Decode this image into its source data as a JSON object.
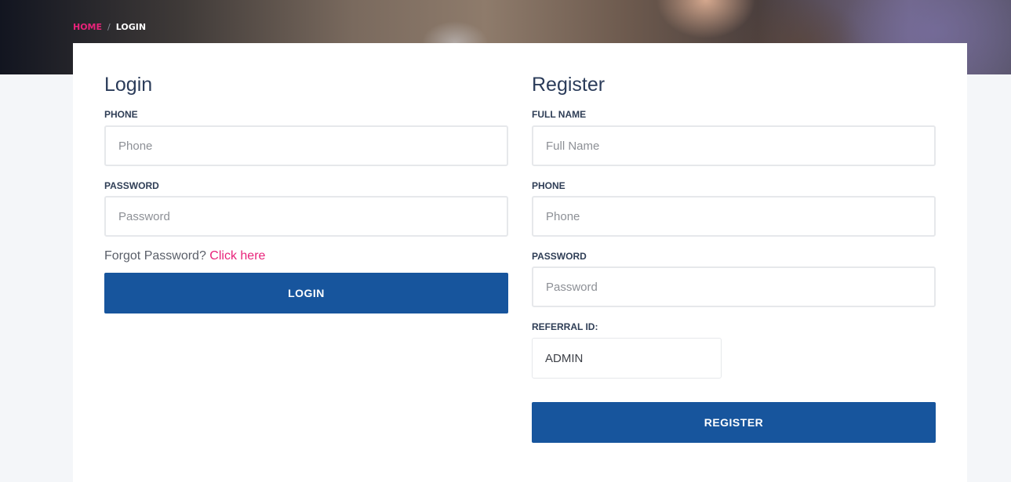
{
  "breadcrumb": {
    "home": "HOME",
    "separator": "/",
    "current": "LOGIN"
  },
  "login": {
    "title": "Login",
    "phone_label": "PHONE",
    "phone_placeholder": "Phone",
    "password_label": "PASSWORD",
    "password_placeholder": "Password",
    "forgot_text": "Forgot Password?",
    "forgot_link": "Click here",
    "button": "LOGIN"
  },
  "register": {
    "title": "Register",
    "fullname_label": "FULL NAME",
    "fullname_placeholder": "Full Name",
    "phone_label": "PHONE",
    "phone_placeholder": "Phone",
    "password_label": "PASSWORD",
    "password_placeholder": "Password",
    "referral_label": "REFERRAL ID:",
    "referral_value": "ADMIN",
    "button": "REGISTER"
  },
  "colors": {
    "accent": "#e8237a",
    "button": "#17559d",
    "heading": "#2b3c5a"
  }
}
